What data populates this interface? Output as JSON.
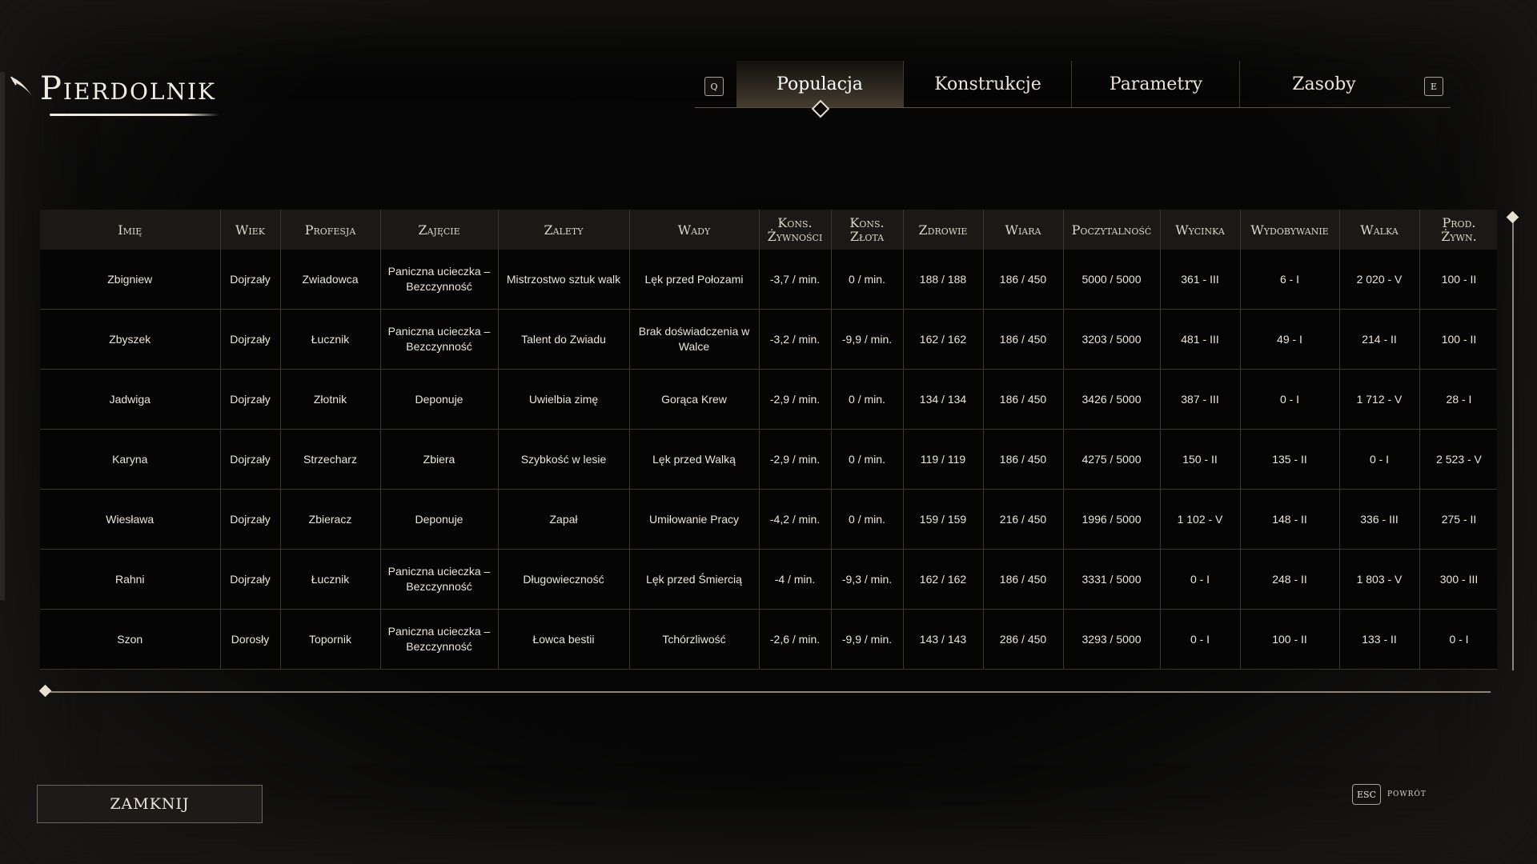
{
  "title": "Pierdolnik",
  "tabs": {
    "left_key": "Q",
    "right_key": "E",
    "items": [
      {
        "label": "Populacja",
        "active": true
      },
      {
        "label": "Konstrukcje",
        "active": false
      },
      {
        "label": "Parametry",
        "active": false
      },
      {
        "label": "Zasoby",
        "active": false
      }
    ]
  },
  "table": {
    "headers": [
      "Imię",
      "Wiek",
      "Profesja",
      "Zajęcie",
      "Zalety",
      "Wady",
      "Kons. Żywności",
      "Kons. Złota",
      "Zdrowie",
      "Wiara",
      "Poczytalność",
      "Wycinka",
      "Wydobywanie",
      "Walka",
      "Prod. Żywn."
    ],
    "rows": [
      [
        "Zbigniew",
        "Dojrzały",
        "Zwiadowca",
        "Paniczna ucieczka – Bezczynność",
        "Mistrzostwo sztuk walk",
        "Lęk przed Połozami",
        "-3,7 / min.",
        "0 / min.",
        "188 / 188",
        "186 / 450",
        "5000 / 5000",
        "361 - III",
        "6 - I",
        "2 020 - V",
        "100 - II"
      ],
      [
        "Zbyszek",
        "Dojrzały",
        "Łucznik",
        "Paniczna ucieczka – Bezczynność",
        "Talent do Zwiadu",
        "Brak doświadczenia w Walce",
        "-3,2 / min.",
        "-9,9 / min.",
        "162 / 162",
        "186 / 450",
        "3203 / 5000",
        "481 - III",
        "49 - I",
        "214 - II",
        "100 - II"
      ],
      [
        "Jadwiga",
        "Dojrzały",
        "Złotnik",
        "Deponuje",
        "Uwielbia zimę",
        "Gorąca Krew",
        "-2,9 / min.",
        "0 / min.",
        "134 / 134",
        "186 / 450",
        "3426 / 5000",
        "387 - III",
        "0 - I",
        "1 712 - V",
        "28 - I"
      ],
      [
        "Karyna",
        "Dojrzały",
        "Strzecharz",
        "Zbiera",
        "Szybkość w lesie",
        "Lęk przed Walką",
        "-2,9 / min.",
        "0 / min.",
        "119 / 119",
        "186 / 450",
        "4275 / 5000",
        "150 - II",
        "135 - II",
        "0 - I",
        "2 523 - V"
      ],
      [
        "Wiesława",
        "Dojrzały",
        "Zbieracz",
        "Deponuje",
        "Zapał",
        "Umiłowanie Pracy",
        "-4,2 / min.",
        "0 / min.",
        "159 / 159",
        "216 / 450",
        "1996 / 5000",
        "1 102 - V",
        "148 - II",
        "336 - III",
        "275 - II"
      ],
      [
        "Rahni",
        "Dojrzały",
        "Łucznik",
        "Paniczna ucieczka – Bezczynność",
        "Długowieczność",
        "Lęk przed Śmiercią",
        "-4 / min.",
        "-9,3 / min.",
        "162 / 162",
        "186 / 450",
        "3331 / 5000",
        "0 - I",
        "248 - II",
        "1 803 - V",
        "300 - III"
      ],
      [
        "Szon",
        "Dorosły",
        "Topornik",
        "Paniczna ucieczka – Bezczynność",
        "Łowca bestii",
        "Tchórzliwość",
        "-2,6 / min.",
        "-9,9 / min.",
        "143 / 143",
        "286 / 450",
        "3293 / 5000",
        "0 - I",
        "100 - II",
        "133 - II",
        "0 - I"
      ]
    ]
  },
  "footer": {
    "close_label": "ZAMKNIJ",
    "esc_key": "ESC",
    "back_label": "powrót"
  },
  "icons": {
    "title": "quill-icon"
  }
}
